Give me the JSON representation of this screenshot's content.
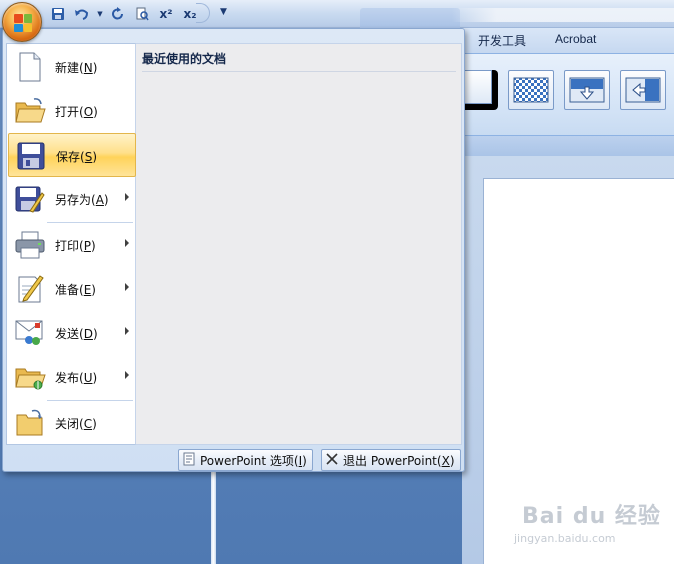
{
  "qat": {
    "items": [
      {
        "name": "save-icon",
        "label": ""
      },
      {
        "name": "undo-icon",
        "label": ""
      },
      {
        "name": "redo-icon",
        "label": ""
      },
      {
        "name": "print-preview-icon",
        "label": ""
      },
      {
        "name": "superscript-icon",
        "label": "x²"
      },
      {
        "name": "subscript-icon",
        "label": "x₂"
      }
    ],
    "customize_label": "▼"
  },
  "ribbon": {
    "tabs": [
      "开发工具",
      "Acrobat"
    ]
  },
  "office_menu": {
    "items": [
      {
        "label": "新建",
        "key": "N",
        "icon": "new-document-icon",
        "has_submenu": false,
        "highlighted": false
      },
      {
        "label": "打开",
        "key": "O",
        "icon": "open-folder-icon",
        "has_submenu": false,
        "highlighted": false
      },
      {
        "label": "保存",
        "key": "S",
        "icon": "save-disk-icon",
        "has_submenu": false,
        "highlighted": true
      },
      {
        "label": "另存为",
        "key": "A",
        "icon": "save-as-icon",
        "has_submenu": true,
        "highlighted": false
      },
      {
        "label": "打印",
        "key": "P",
        "icon": "printer-icon",
        "has_submenu": true,
        "highlighted": false
      },
      {
        "label": "准备",
        "key": "E",
        "icon": "prepare-icon",
        "has_submenu": true,
        "highlighted": false
      },
      {
        "label": "发送",
        "key": "D",
        "icon": "send-icon",
        "has_submenu": true,
        "highlighted": false
      },
      {
        "label": "发布",
        "key": "U",
        "icon": "publish-icon",
        "has_submenu": true,
        "highlighted": false
      },
      {
        "label": "关闭",
        "key": "C",
        "icon": "close-folder-icon",
        "has_submenu": false,
        "highlighted": false
      }
    ],
    "recent_header": "最近使用的文档",
    "footer": {
      "options_label": "PowerPoint 选项",
      "options_key": "I",
      "exit_label": "退出 PowerPoint",
      "exit_key": "X"
    }
  },
  "watermark": {
    "main": "Bai du 经验",
    "sub": "jingyan.baidu.com"
  },
  "colors": {
    "highlight": "#ffd35a",
    "menu_bg": "#dde8f6",
    "recent_bg": "#ececee",
    "office_orange": "#d86a12"
  }
}
